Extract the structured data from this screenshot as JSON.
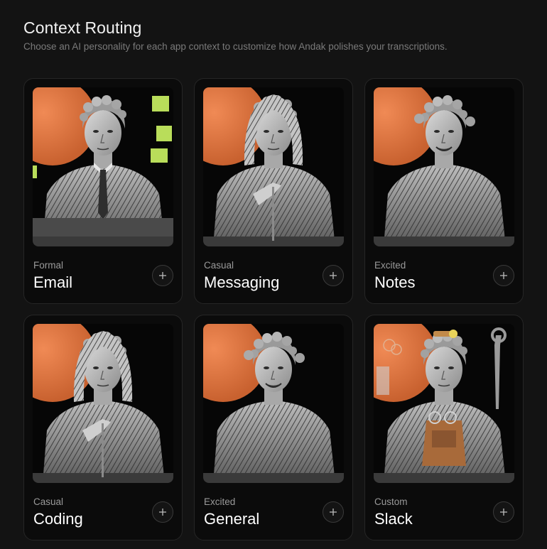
{
  "header": {
    "title": "Context Routing",
    "subtitle": "Choose an AI personality for each app context to customize how Andak polishes your transcriptions."
  },
  "colors": {
    "background": "#131313",
    "card": "#0b0b0b",
    "accent_orange": "#e07a48"
  },
  "contexts": [
    {
      "personality": "Formal",
      "name": "Email",
      "art": "formal-statue-tie-icon"
    },
    {
      "personality": "Casual",
      "name": "Messaging",
      "art": "casual-statue-hood-icon"
    },
    {
      "personality": "Excited",
      "name": "Notes",
      "art": "excited-statue-smile-icon"
    },
    {
      "personality": "Casual",
      "name": "Coding",
      "art": "casual-statue-hood-icon"
    },
    {
      "personality": "Excited",
      "name": "General",
      "art": "excited-statue-smile-icon"
    },
    {
      "personality": "Custom",
      "name": "Slack",
      "art": "custom-statue-tools-icon"
    }
  ]
}
